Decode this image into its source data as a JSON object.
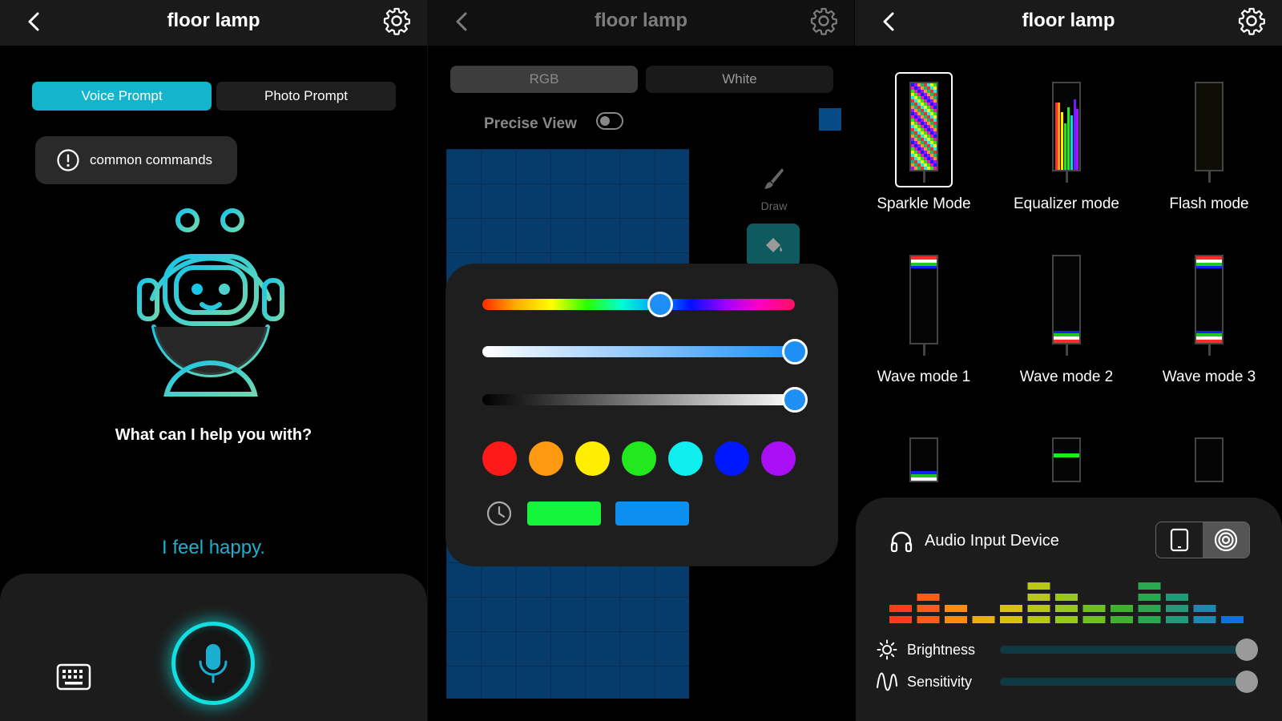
{
  "device_title": "floor lamp",
  "panel1": {
    "tabs": [
      {
        "label": "Voice Prompt",
        "active": true
      },
      {
        "label": "Photo Prompt",
        "active": false
      }
    ],
    "commands_label": "common commands",
    "question": "What can I help you with?",
    "utterance": "I feel happy.",
    "accent": "#14b4cc"
  },
  "panel2": {
    "tabs": [
      {
        "label": "RGB",
        "active": true
      },
      {
        "label": "White",
        "active": false
      }
    ],
    "precise_view_label": "Precise View",
    "precise_view_on": false,
    "draw_label": "Draw",
    "sliders": {
      "hue_fraction": 0.57,
      "saturation_fraction": 1.0,
      "brightness_fraction": 1.0
    },
    "swatches": [
      "#ff1a1a",
      "#ff9a10",
      "#ffee00",
      "#22e81e",
      "#10eef0",
      "#0018ff",
      "#aa10f5"
    ],
    "presets": [
      "#12f53a",
      "#0b8ff0"
    ],
    "selected_color": "#064a86"
  },
  "panel3": {
    "modes": [
      {
        "label": "Sparkle Mode",
        "selected": true
      },
      {
        "label": "Equalizer mode",
        "selected": false
      },
      {
        "label": "Flash mode",
        "selected": false
      },
      {
        "label": "Wave mode 1",
        "selected": false
      },
      {
        "label": "Wave mode 2",
        "selected": false
      },
      {
        "label": "Wave mode 3",
        "selected": false
      }
    ],
    "audio_input_label": "Audio Input Device",
    "audio_input_selected": "microphone",
    "brightness_label": "Brightness",
    "brightness_fraction": 1.0,
    "sensitivity_label": "Sensitivity",
    "sensitivity_fraction": 1.0
  }
}
